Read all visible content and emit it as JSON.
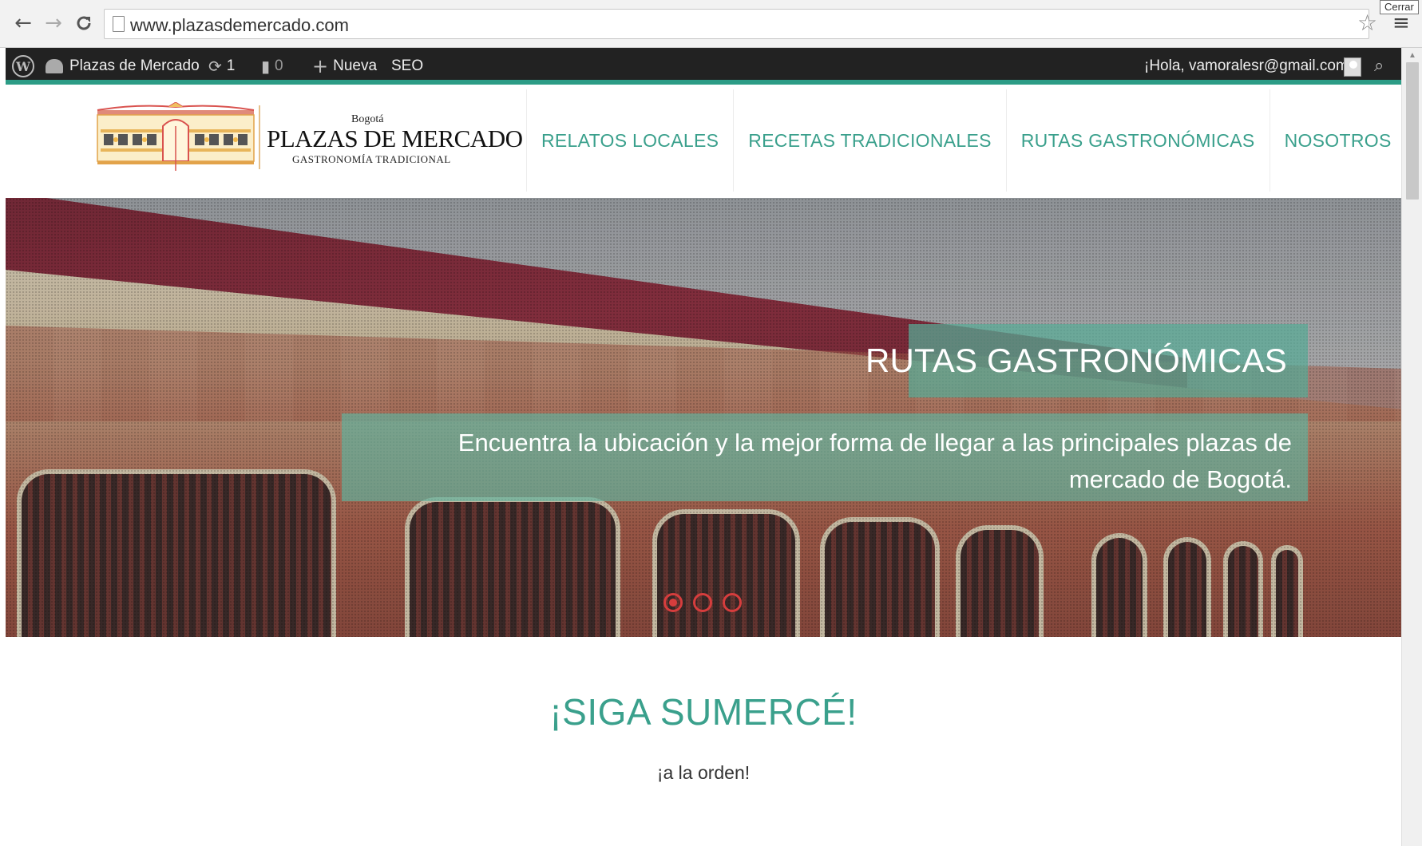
{
  "browser": {
    "url": "www.plazasdemercado.com",
    "tooltip": "Cerrar",
    "back_icon": "←",
    "forward_icon": "→",
    "reload_icon": "C",
    "star_icon": "☆",
    "menu_icon": "≡"
  },
  "admin_bar": {
    "site_name": "Plazas de Mercado",
    "updates_count": "1",
    "comments_count": "0",
    "new_label": "Nueva",
    "seo_label": "SEO",
    "greeting": "¡Hola, vamoralesr@gmail.com!",
    "wp_logo_glyph": "W",
    "updates_icon": "⟳",
    "comments_icon": "▮",
    "new_icon": "+",
    "search_icon": "⌕",
    "accent_color": "#2c9c86"
  },
  "logo": {
    "small": "Bogotá",
    "main": "PLAZAS DE MERCADO",
    "sub": "GASTRONOMÍA TRADICIONAL"
  },
  "nav": {
    "items": [
      {
        "label": "RELATOS LOCALES"
      },
      {
        "label": "RECETAS TRADICIONALES"
      },
      {
        "label": "RUTAS GASTRONÓMICAS"
      },
      {
        "label": "NOSOTROS"
      }
    ],
    "search_icon": "⌕",
    "link_color": "#3aa08c"
  },
  "hero": {
    "title": "RUTAS GASTRONÓMICAS",
    "subtitle": "Encuentra la ubicación y la mejor forma de llegar a las principales plazas de mercado de Bogotá.",
    "slides": 3,
    "active_slide": 1,
    "dot_color": "#d63d3d"
  },
  "intro": {
    "title": "¡SIGA SUMERCÉ!",
    "subtitle": "¡a la orden!"
  }
}
